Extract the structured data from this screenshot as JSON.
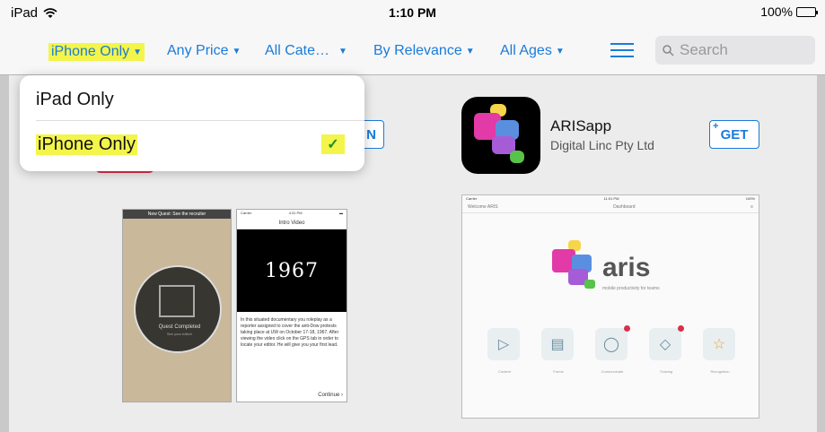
{
  "status_bar": {
    "carrier": "iPad",
    "wifi_icon": "wifi-icon",
    "time": "1:10 PM",
    "battery": "100%"
  },
  "filters": {
    "device": "iPhone Only",
    "price": "Any Price",
    "category": "All Cate…",
    "sort": "By Relevance",
    "ages": "All Ages",
    "list_icon": "list-icon"
  },
  "search": {
    "placeholder": "Search",
    "value": ""
  },
  "dropdown": {
    "items": [
      {
        "label": "iPad Only",
        "selected": false
      },
      {
        "label": "iPhone Only",
        "selected": true
      }
    ],
    "check": "✓"
  },
  "apps": [
    {
      "button_label": "N"
    },
    {
      "name": "ARISapp",
      "developer": "Digital Linc Pty Ltd",
      "button_label": "GET"
    }
  ],
  "screenshots": {
    "shot1": {
      "top_title": "New Quest: See the recruiter",
      "quest_title": "Quest Completed",
      "quest_sub": "See your editor!"
    },
    "shot2": {
      "carrier": "Carrier",
      "time": "4:31 PM",
      "title": "Intro Video",
      "video_text": "1967",
      "description": "In this situated documentary you roleplay as a reporter assigned to cover the anti-Dow protests taking place at UW on October 17-18, 1967. After viewing the video click on the GPS tab in order to locate your editor. He will give you your first lead.",
      "continue": "Continue"
    },
    "shot3": {
      "carrier": "Carrier",
      "time": "11:01 PM",
      "battery": "100%",
      "welcome": "Welcome ARIS",
      "title": "Dashboard",
      "logo_word": "aris",
      "tagline": "mobile productivity for teams",
      "tiles": [
        "Content",
        "Forms",
        "Communicate",
        "Training",
        "Recognition"
      ]
    }
  },
  "colors": {
    "accent": "#1a7bd9",
    "highlight": "#f3f54b",
    "check": "#1f8f1f"
  }
}
